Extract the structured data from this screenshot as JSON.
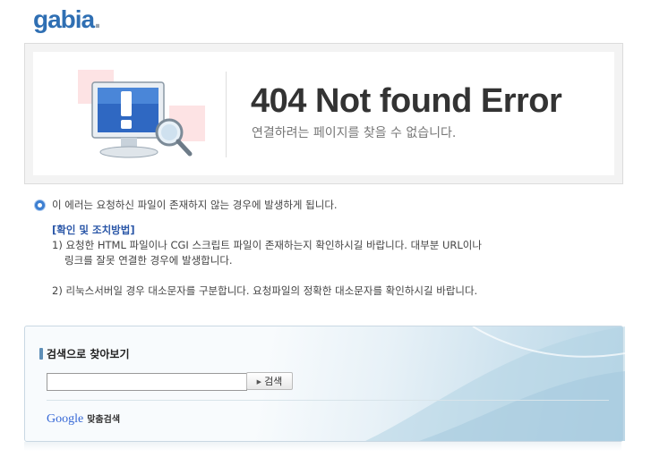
{
  "logo": {
    "text_main": "gabia",
    "text_dot": "."
  },
  "error": {
    "title": "404 Not found Error",
    "subtitle": "연결하려는 페이지를 찾을 수 없습니다."
  },
  "info": {
    "lead": "이 에러는 요청하신 파일이 존재하지 않는 경우에 발생하게 됩니다.",
    "heading": "[확인 및 조치방법]",
    "line1": "1) 요청한 HTML 파일이나 CGI 스크립트 파일이 존재하는지 확인하시길 바랍니다. 대부분 URL이나",
    "line2": "링크를 잘못 연결한 경우에 발생합니다.",
    "line3": "2) 리눅스서버일 경우 대소문자를 구분합니다. 요청파일의 정확한 대소문자를 확인하시길 바랍니다."
  },
  "search": {
    "title": "검색으로 찾아보기",
    "input_value": "",
    "button_label": "검색",
    "google_label": "Google",
    "google_suffix": "맞춤검색"
  },
  "colors": {
    "logo": "#2f6fb3",
    "heading": "#2b57a8",
    "error_title": "#333333"
  }
}
